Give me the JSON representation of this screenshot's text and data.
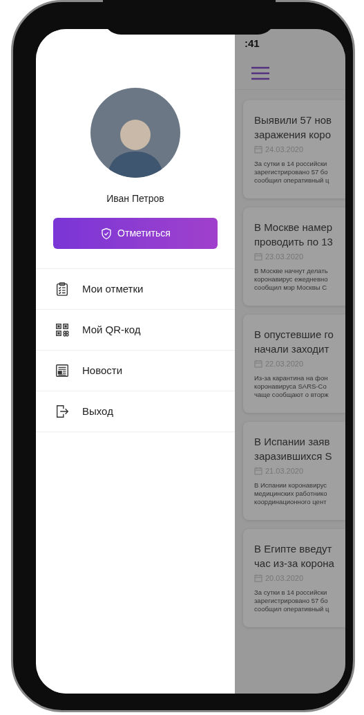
{
  "status_bar": {
    "time": ":41"
  },
  "drawer": {
    "user_name": "Иван Петров",
    "check_in_button": "Отметиться",
    "menu": [
      {
        "kind": "checklist",
        "label": "Мои отметки"
      },
      {
        "kind": "qr",
        "label": "Мой QR-код"
      },
      {
        "kind": "news",
        "label": "Новости"
      },
      {
        "kind": "logout",
        "label": "Выход"
      }
    ]
  },
  "news": [
    {
      "title_lines": [
        "Выявили 57 нов",
        "заражения коро"
      ],
      "date": "24.03.2020",
      "summary_lines": [
        "За сутки в 14 российски",
        "зарегистрировано 57 бо",
        "сообщил оперативный ц"
      ]
    },
    {
      "title_lines": [
        "В Москве намер",
        "проводить по 13"
      ],
      "date": "23.03.2020",
      "summary_lines": [
        "В Москве начнут делать",
        "коронавирус ежедневно",
        "сообщил мэр Москвы С"
      ]
    },
    {
      "title_lines": [
        "В опустевшие го",
        "начали заходит"
      ],
      "date": "22.03.2020",
      "summary_lines": [
        "Из-за карантина на фон",
        "коронавируса SARS-Co",
        "чаще сообщают о вторж"
      ]
    },
    {
      "title_lines": [
        "В Испании заяв",
        "заразившихся S"
      ],
      "date": "21.03.2020",
      "summary_lines": [
        "В Испании коронавирус",
        "медицинских работнико",
        "координационного цент"
      ]
    },
    {
      "title_lines": [
        "В Египте введут",
        "час из-за корона"
      ],
      "date": "20.03.2020",
      "summary_lines": [
        "За сутки в 14 российски",
        "зарегистрировано 57 бо",
        "сообщил оперативный ц"
      ]
    }
  ]
}
